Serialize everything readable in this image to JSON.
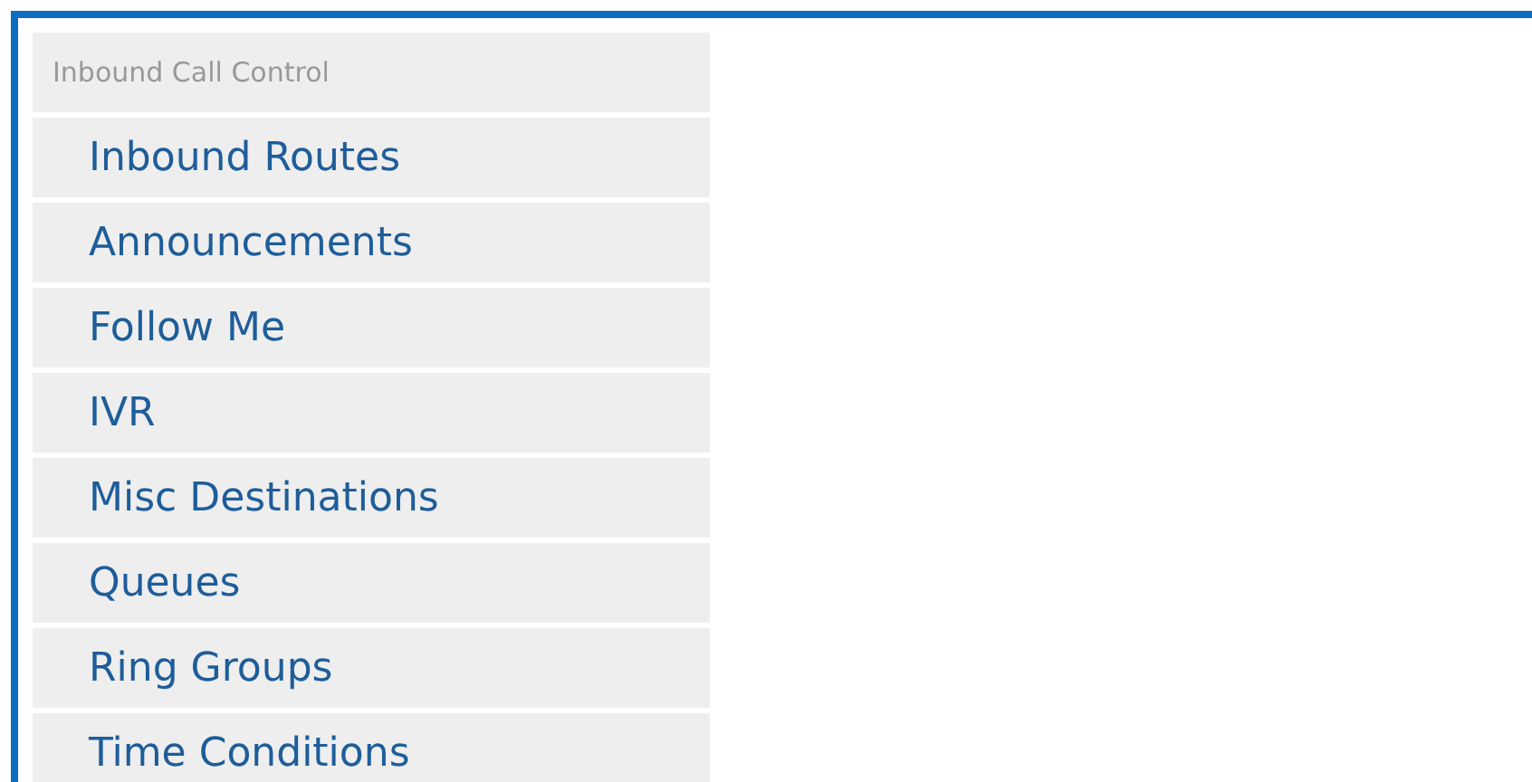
{
  "menu": {
    "heading": "Inbound Call Control",
    "items": [
      {
        "label": "Inbound Routes"
      },
      {
        "label": "Announcements"
      },
      {
        "label": "Follow Me"
      },
      {
        "label": "IVR"
      },
      {
        "label": "Misc Destinations"
      },
      {
        "label": "Queues"
      },
      {
        "label": "Ring Groups"
      },
      {
        "label": "Time Conditions"
      }
    ]
  }
}
